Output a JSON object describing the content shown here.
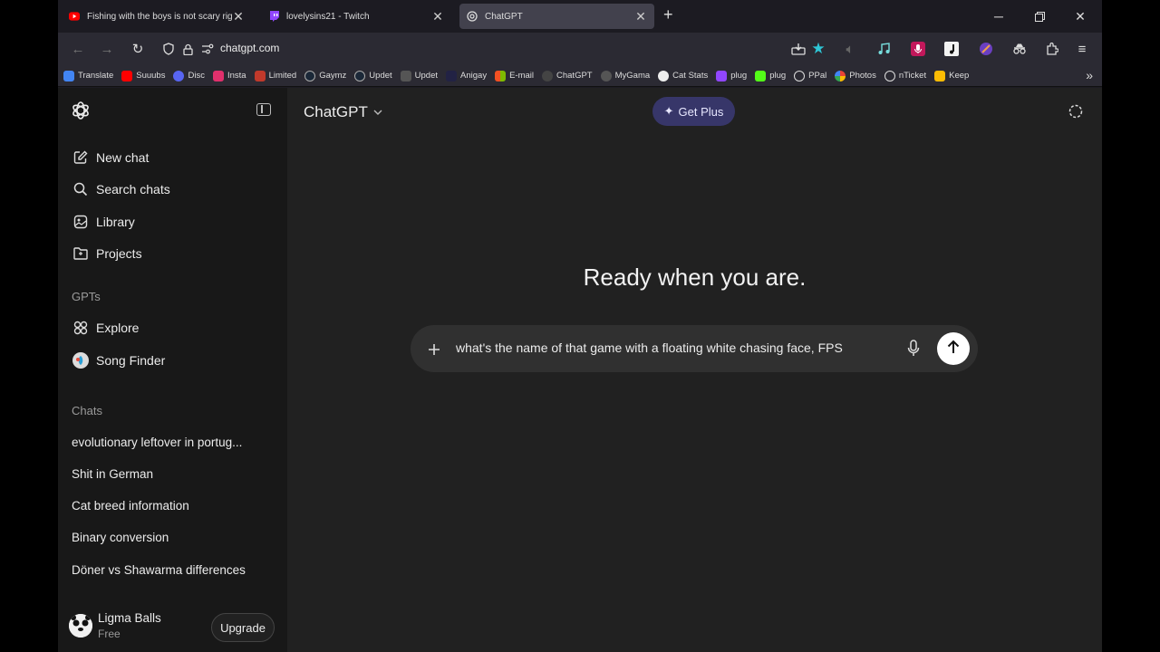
{
  "browser": {
    "tabs": [
      {
        "title": "Fishing with the boys is not scary right",
        "icon": "youtube-icon"
      },
      {
        "title": "lovelysins21 - Twitch",
        "icon": "twitch-icon"
      },
      {
        "title": "ChatGPT",
        "icon": "chatgpt-icon"
      }
    ],
    "url": "chatgpt.com",
    "bookmarks": [
      {
        "label": "Translate",
        "color": "#4285f4"
      },
      {
        "label": "Suuubs",
        "color": "#ff0000"
      },
      {
        "label": "Disc",
        "color": "#5865f2"
      },
      {
        "label": "Insta",
        "color": "#e1306c"
      },
      {
        "label": "Limited",
        "color": "#c0392b"
      },
      {
        "label": "Gaymz",
        "color": "#1b2838"
      },
      {
        "label": "Updet",
        "color": "#1b2838"
      },
      {
        "label": "Updet",
        "color": "#555555"
      },
      {
        "label": "Anigay",
        "color": "#222244"
      },
      {
        "label": "E-mail",
        "color": "#00a4ef"
      },
      {
        "label": "ChatGPT",
        "color": "#444444"
      },
      {
        "label": "MyGama",
        "color": "#555555"
      },
      {
        "label": "Cat Stats",
        "color": "#eeeeee"
      },
      {
        "label": "plug",
        "color": "#9146ff"
      },
      {
        "label": "plug",
        "color": "#53fc18"
      },
      {
        "label": "PPal",
        "color": "#666666"
      },
      {
        "label": "Photos",
        "color": "#fbbc04"
      },
      {
        "label": "nTicket",
        "color": "#666666"
      },
      {
        "label": "Keep",
        "color": "#fbbc04"
      }
    ]
  },
  "sidebar": {
    "nav": [
      {
        "label": "New chat",
        "icon": "edit-icon"
      },
      {
        "label": "Search chats",
        "icon": "search-icon"
      },
      {
        "label": "Library",
        "icon": "library-icon"
      },
      {
        "label": "Projects",
        "icon": "folder-icon"
      }
    ],
    "gpts_heading": "GPTs",
    "gpts": [
      {
        "label": "Explore",
        "icon": "grid-icon"
      },
      {
        "label": "Song Finder",
        "icon": "song-finder-icon"
      }
    ],
    "chats_heading": "Chats",
    "chats": [
      "evolutionary leftover in portug...",
      "Shit in German",
      "Cat breed information",
      "Binary conversion",
      "Döner vs Shawarma differences"
    ],
    "user": {
      "name": "Ligma Balls",
      "plan": "Free",
      "upgrade_label": "Upgrade"
    }
  },
  "main": {
    "model_label": "ChatGPT",
    "get_plus_label": "Get Plus",
    "hero": "Ready when you are.",
    "prompt_value": "what's the name of that game with a floating white chasing face, FPS"
  },
  "colors": {
    "accent": "#373669",
    "sidebar_bg": "#181818",
    "main_bg": "#212121",
    "composer_bg": "#303030"
  }
}
